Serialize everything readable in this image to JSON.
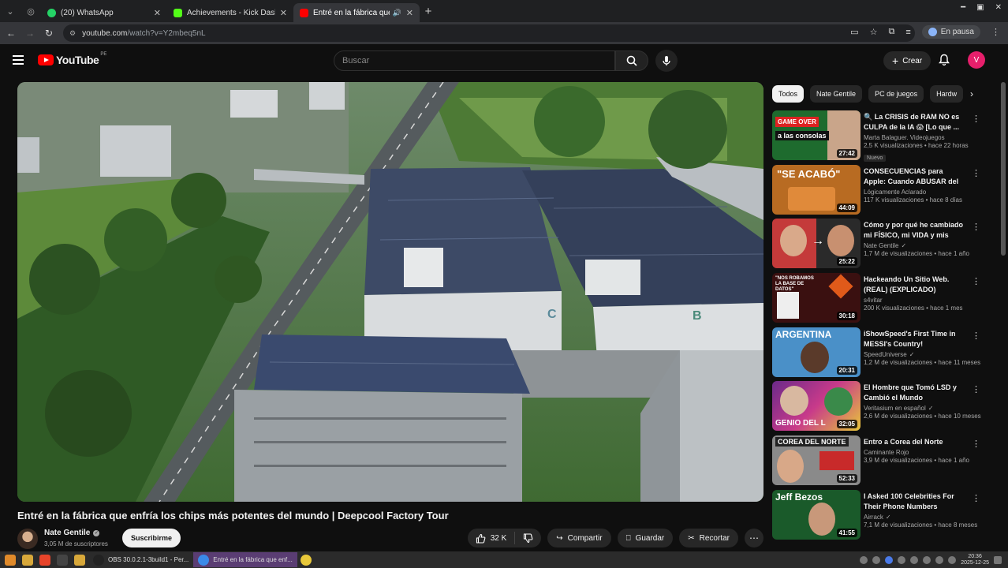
{
  "browser": {
    "tabs": [
      {
        "title": "(20) WhatsApp",
        "color": "#25d366",
        "active": false
      },
      {
        "title": "Achievements - Kick Dashbo",
        "color": "#53fc18",
        "active": false
      },
      {
        "title": "Entré en la fábrica que e",
        "color": "#ff0000",
        "active": true
      }
    ],
    "url_host": "youtube.com",
    "url_path": "/watch?v=Y2mbeq5nL",
    "profile_label": "En pausa"
  },
  "header": {
    "logo_text": "YouTube",
    "logo_country": "PE",
    "search_placeholder": "Buscar",
    "create_label": "Crear",
    "avatar_letter": "V"
  },
  "video": {
    "title": "Entré en la fábrica que enfría los chips más potentes del mundo | Deepcool Factory Tour",
    "building_labels": [
      "C",
      "B"
    ],
    "channel_name": "Nate Gentile",
    "subscribers": "3,05 M de suscriptores",
    "subscribe_label": "Suscribirme",
    "likes": "32 K",
    "share_label": "Compartir",
    "save_label": "Guardar",
    "clip_label": "Recortar"
  },
  "chips": [
    "Todos",
    "Nate Gentile",
    "PC de juegos",
    "Hardw"
  ],
  "recommendations": [
    {
      "title": "🔍 La CRISIS de RAM NO es CULPA de la IA 😱 [Lo que ...",
      "channel": "Marta Balaguer. Videojuegos",
      "views": "2,5 K visualizaciones • hace 22 horas",
      "duration": "27:42",
      "badge": "Nuevo",
      "thumb_text": "a las consolas",
      "thumb_color": "#1e6b2e",
      "verified": false
    },
    {
      "title": "CONSECUENCIAS para Apple: Cuando ABUSAR del Usuario ...",
      "channel": "Lógicamente Aclarado",
      "views": "117 K visualizaciones • hace 8 días",
      "duration": "44:09",
      "badge": "",
      "thumb_text": "\"SE ACABÓ\"",
      "thumb_color": "#b86b22",
      "verified": false
    },
    {
      "title": "Cómo y por qué he cambiado mi FÍSICO, mi VIDA y mis HÁBITOS",
      "channel": "Nate Gentile",
      "views": "1,7 M de visualizaciones • hace 1 año",
      "duration": "25:22",
      "badge": "",
      "thumb_text": "",
      "thumb_color": "#c43a3a",
      "verified": true
    },
    {
      "title": "Hackeando Un Sitio Web. (REAL) (EXPLICADO)",
      "channel": "s4vitar",
      "views": "200 K visualizaciones • hace 1 mes",
      "duration": "30:18",
      "badge": "",
      "thumb_text": "\"NOS ROBAMOS LA BASE DE DATOS\"",
      "thumb_color": "#3a1010",
      "verified": false
    },
    {
      "title": "iShowSpeed's First Time in MESSI's Country!",
      "channel": "SpeedUniverse",
      "views": "1,2 M de visualizaciones • hace 11 meses",
      "duration": "20:31",
      "badge": "",
      "thumb_text": "ARGENTINA",
      "thumb_color": "#4a90c8",
      "verified": true
    },
    {
      "title": "El Hombre que Tomó LSD y Cambió el Mundo",
      "channel": "Veritasium en español",
      "views": "2,6 M de visualizaciones • hace 10 meses",
      "duration": "32:05",
      "badge": "",
      "thumb_text": "GENIO DEL L",
      "thumb_color": "#6b2a8a",
      "verified": true
    },
    {
      "title": "Entro a Corea del Norte",
      "channel": "Caminante Rojo",
      "views": "3,9 M de visualizaciones • hace 1 año",
      "duration": "52:33",
      "badge": "",
      "thumb_text": "COREA DEL NORTE",
      "thumb_color": "#8a8a8a",
      "verified": false
    },
    {
      "title": "I Asked 100 Celebrities For Their Phone Numbers",
      "channel": "Airrack",
      "views": "7,1 M de visualizaciones • hace 8 meses",
      "duration": "41:55",
      "badge": "",
      "thumb_text": "Jeff Bezos",
      "thumb_color": "#1a5a2a",
      "verified": true
    }
  ],
  "taskbar": {
    "apps": [
      {
        "label": "OBS 30.0.2.1-3build1 - Per...",
        "active": false
      },
      {
        "label": "Entré en la fábrica que enf...",
        "active": true
      }
    ],
    "time": "20:36",
    "date": "2025-12-25"
  }
}
